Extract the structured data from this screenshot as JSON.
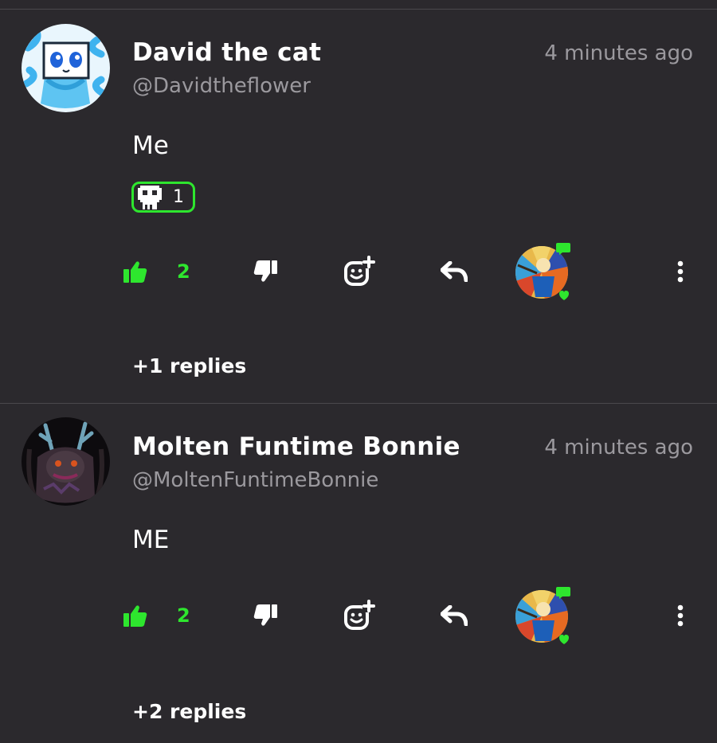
{
  "colors": {
    "background": "#2b292d",
    "accent_green": "#2ee62e",
    "muted_text": "#9b999e",
    "divider": "#4a484d"
  },
  "comments": [
    {
      "username": "David the cat",
      "handle": "@Davidtheflower",
      "timestamp": "4 minutes ago",
      "text": "Me",
      "reaction": {
        "icon": "skull-icon",
        "count": "1"
      },
      "likes": "2",
      "replies_label": "+1 replies"
    },
    {
      "username": "Molten Funtime Bonnie",
      "handle": "@MoltenFuntimeBonnie",
      "timestamp": "4 minutes ago",
      "text": "ME",
      "likes": "2",
      "replies_label": "+2 replies"
    }
  ],
  "icons": {
    "like": "thumbs-up-icon",
    "dislike": "thumbs-down-icon",
    "add_reaction": "add-reaction-icon",
    "reply": "reply-arrow-icon",
    "more": "more-vertical-icon"
  }
}
